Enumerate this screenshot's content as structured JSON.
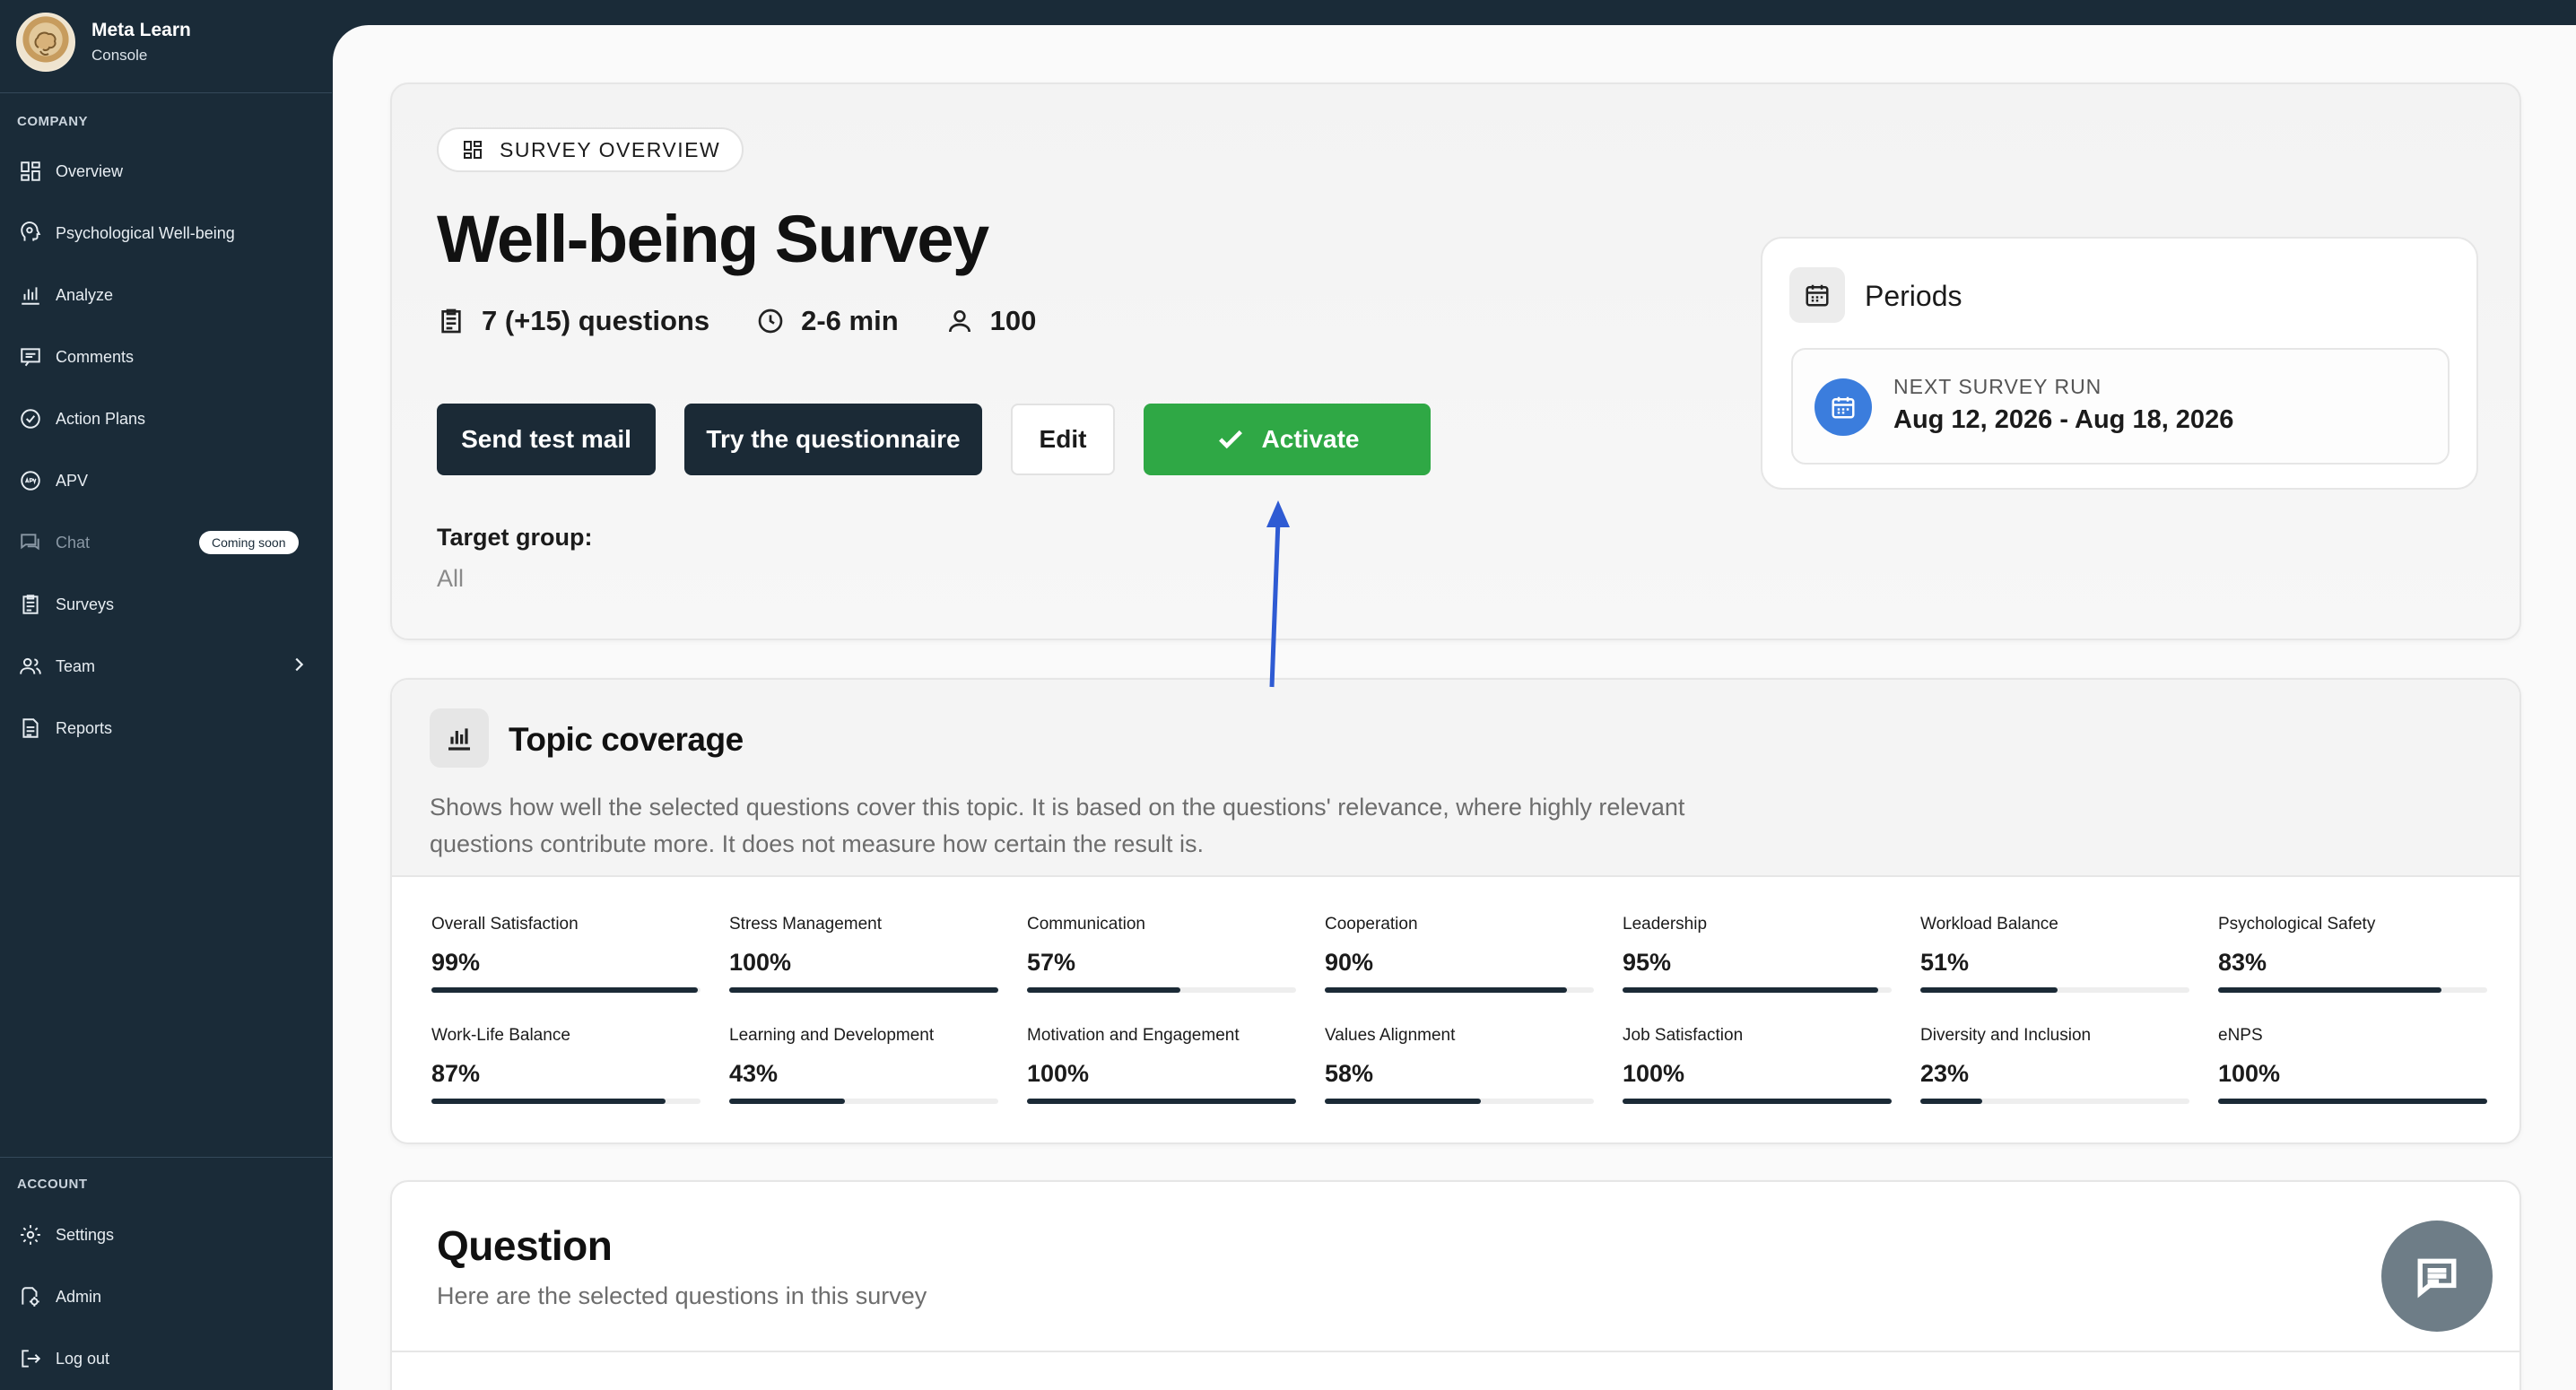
{
  "brand": {
    "name": "Meta Learn",
    "subtitle": "Console"
  },
  "sidebar": {
    "company_label": "COMPANY",
    "account_label": "ACCOUNT",
    "items": [
      {
        "label": "Overview",
        "icon": "grid-icon"
      },
      {
        "label": "Psychological Well-being",
        "icon": "head-icon"
      },
      {
        "label": "Analyze",
        "icon": "bar-chart-icon"
      },
      {
        "label": "Comments",
        "icon": "comment-icon"
      },
      {
        "label": "Action Plans",
        "icon": "check-circle-icon"
      },
      {
        "label": "APV",
        "icon": "apv-icon"
      },
      {
        "label": "Chat",
        "icon": "chat-icon",
        "badge": "Coming soon"
      },
      {
        "label": "Surveys",
        "icon": "clipboard-icon"
      },
      {
        "label": "Team",
        "icon": "team-icon"
      },
      {
        "label": "Reports",
        "icon": "report-icon"
      }
    ],
    "account_items": [
      {
        "label": "Settings",
        "icon": "gear-icon"
      },
      {
        "label": "Admin",
        "icon": "admin-icon"
      },
      {
        "label": "Log out",
        "icon": "logout-icon"
      }
    ]
  },
  "overview": {
    "chip": "SURVEY OVERVIEW",
    "title": "Well-being Survey",
    "questions": "7 (+15) questions",
    "duration": "2-6 min",
    "participants": "100",
    "buttons": {
      "send_test": "Send test mail",
      "try": "Try the questionnaire",
      "edit": "Edit",
      "activate": "Activate"
    },
    "target_group_label": "Target group:",
    "target_group_value": "All"
  },
  "periods": {
    "title": "Periods",
    "next_label": "NEXT SURVEY RUN",
    "next_range": "Aug 12, 2026 - Aug 18, 2026"
  },
  "topic": {
    "title": "Topic coverage",
    "description": "Shows how well the selected questions cover this topic. It is based on the questions' relevance, where highly relevant questions contribute more. It does not measure how certain the result is.",
    "metrics": [
      {
        "name": "Overall Satisfaction",
        "value": "99%",
        "pct": 99
      },
      {
        "name": "Stress Management",
        "value": "100%",
        "pct": 100
      },
      {
        "name": "Communication",
        "value": "57%",
        "pct": 57
      },
      {
        "name": "Cooperation",
        "value": "90%",
        "pct": 90
      },
      {
        "name": "Leadership",
        "value": "95%",
        "pct": 95
      },
      {
        "name": "Workload Balance",
        "value": "51%",
        "pct": 51
      },
      {
        "name": "Psychological Safety",
        "value": "83%",
        "pct": 83
      },
      {
        "name": "Work-Life Balance",
        "value": "87%",
        "pct": 87
      },
      {
        "name": "Learning and Development",
        "value": "43%",
        "pct": 43
      },
      {
        "name": "Motivation and Engagement",
        "value": "100%",
        "pct": 100
      },
      {
        "name": "Values Alignment",
        "value": "58%",
        "pct": 58
      },
      {
        "name": "Job Satisfaction",
        "value": "100%",
        "pct": 100
      },
      {
        "name": "Diversity and Inclusion",
        "value": "23%",
        "pct": 23
      },
      {
        "name": "eNPS",
        "value": "100%",
        "pct": 100
      }
    ]
  },
  "questions": {
    "title": "Question",
    "subtitle": "Here are the selected questions in this survey"
  },
  "colors": {
    "sidebar_bg": "#1a2b38",
    "dark_button": "#1b2a36",
    "activate_green": "#2fa845",
    "period_blue": "#3b7ddd",
    "annotation_arrow": "#2f5bd3"
  }
}
